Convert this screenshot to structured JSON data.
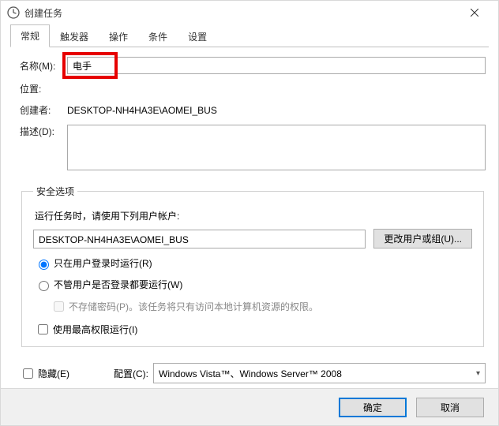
{
  "window": {
    "title": "创建任务"
  },
  "tabs": {
    "items": [
      "常规",
      "触发器",
      "操作",
      "条件",
      "设置"
    ],
    "activeIndex": 0
  },
  "general": {
    "name_label": "名称(M):",
    "name_value": "电手",
    "location_label": "位置:",
    "location_value": "",
    "creator_label": "创建者:",
    "creator_value": "DESKTOP-NH4HA3E\\AOMEI_BUS",
    "description_label": "描述(D):",
    "description_value": ""
  },
  "security": {
    "legend": "安全选项",
    "prompt": "运行任务时，请使用下列用户帐户:",
    "user_account": "DESKTOP-NH4HA3E\\AOMEI_BUS",
    "change_user_btn": "更改用户或组(U)...",
    "radio_logged_on": "只在用户登录时运行(R)",
    "radio_any_time": "不管用户是否登录都要运行(W)",
    "no_store_pwd": "不存储密码(P)。该任务将只有访问本地计算机资源的权限。",
    "highest_priv": "使用最高权限运行(I)",
    "radio_selected": "logged_on"
  },
  "bottom": {
    "hidden_label": "隐藏(E)",
    "configure_label": "配置(C):",
    "configure_value": "Windows Vista™、Windows Server™ 2008"
  },
  "footer": {
    "ok": "确定",
    "cancel": "取消"
  }
}
